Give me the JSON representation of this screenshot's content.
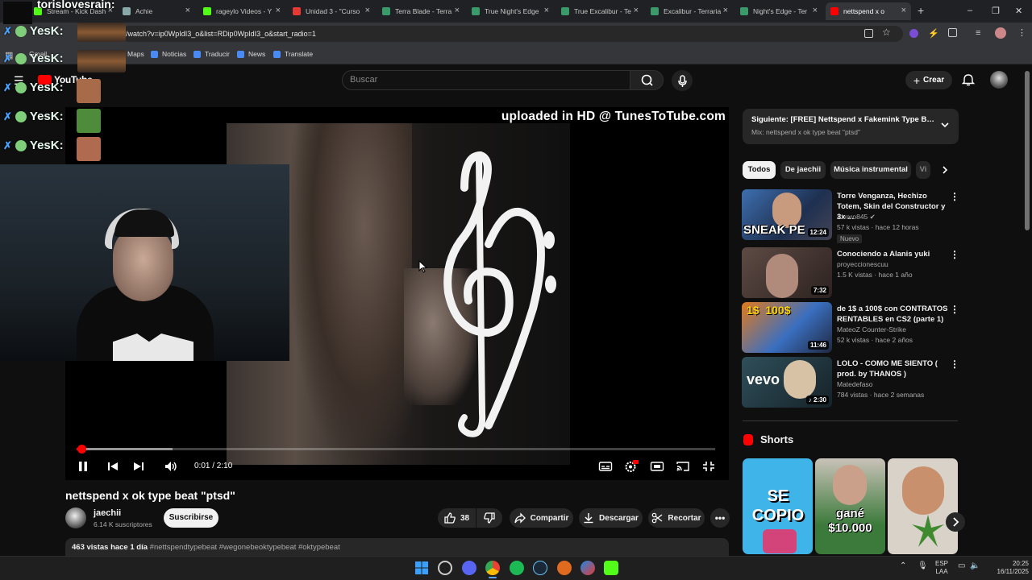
{
  "browser": {
    "tabs": [
      {
        "label": "Stream - Kick Dash",
        "color": "#53fc18"
      },
      {
        "label": "Achie",
        "color": "#8aa"
      },
      {
        "label": "rageylo Videos - Y",
        "color": "#53fc18"
      },
      {
        "label": "Unidad 3 - \"Curso",
        "color": "#e53935"
      },
      {
        "label": "Terra Blade - Terra",
        "color": "#3a9a6a"
      },
      {
        "label": "True Night's Edge",
        "color": "#3a9a6a"
      },
      {
        "label": "True Excalibur - Te",
        "color": "#3a9a6a"
      },
      {
        "label": "Excalibur - Terraria",
        "color": "#3a9a6a"
      },
      {
        "label": "Night's Edge - Ter",
        "color": "#3a9a6a"
      },
      {
        "label": "nettspend x o",
        "color": "#ff0000"
      }
    ],
    "new_tab": "+",
    "url": "/watch?v=ip0WpIdI3_o&list=RDip0WpIdI3_o&start_radio=1",
    "bookmarks": [
      "Gmail",
      "Maps",
      "Noticias",
      "Traducir",
      "News",
      "Translate"
    ]
  },
  "youtube": {
    "logo_text": "YouTube",
    "search_placeholder": "Buscar",
    "create_label": "Crear"
  },
  "stream_overlay": {
    "streamer": "torislovesrain:",
    "chat": [
      "YesK:",
      "YesK:",
      "YesK:",
      "YesK:",
      "YesK:"
    ]
  },
  "player": {
    "overlay_text": "uploaded in HD @ TunesToTube.com",
    "time": "0:01 / 2:10",
    "played_fraction": 0.0076,
    "buffered_fraction": 0.15
  },
  "video": {
    "title": "nettspend x ok type beat \"ptsd\"",
    "channel": "jaechii",
    "subscribers": "6.14 K suscriptores",
    "subscribe_label": "Suscribirse",
    "likes": "38",
    "share_label": "Compartir",
    "download_label": "Descargar",
    "clip_label": "Recortar",
    "views_date": "463 vistas  hace 1 día",
    "hashtags": "#nettspendtypebeat #wegonebeoktypebeat #oktypebeat"
  },
  "sidebar": {
    "next_title": "Siguiente: [FREE] Nettspend x Fakemink Type Beat -...",
    "next_sub": "Mix: nettspend x ok type beat \"ptsd\"",
    "chips": [
      "Todos",
      "De jaechii",
      "Música instrumental",
      "Vi"
    ],
    "recommendations": [
      {
        "title": "Torre Venganza, Hechizo Totem, Skin del Constructor y 3x ...",
        "channel": "Alvaro845 ✔",
        "meta": "57 k vistas · hace 12 horas",
        "duration": "12:24",
        "badge": "Nuevo",
        "thumb_text": "SNEAK PE"
      },
      {
        "title": "Conociendo a Alanis yuki",
        "channel": "proyeccionescuu",
        "meta": "1.5 K vistas · hace 1 año",
        "duration": "7:32",
        "badge": "",
        "thumb_text": ""
      },
      {
        "title": "de 1$ a 100$ con CONTRATOS RENTABLES en CS2 (parte 1)",
        "channel": "MateoZ Counter-Strike",
        "meta": "52 k vistas · hace 2 años",
        "duration": "11:46",
        "badge": "",
        "thumb_text": "1$  100$"
      },
      {
        "title": "LOLO - COMO ME SIENTO ( prod. by THANOS )",
        "channel": "Matedefaso",
        "meta": "784 vistas · hace 2 semanas",
        "duration": "♪ 2:30",
        "badge": "",
        "thumb_text": "vevo"
      }
    ],
    "shorts_title": "Shorts",
    "shorts": [
      {
        "text": "SE COPIO",
        "bg": "#3fb4e8"
      },
      {
        "text": "gané $10.000",
        "bg": "#3b7a3a"
      },
      {
        "text": "",
        "bg": "#d8d2c8"
      }
    ]
  },
  "taskbar": {
    "lang": "ESP",
    "layout": "LAA",
    "time": "20:25",
    "date": "16/11/2025"
  }
}
